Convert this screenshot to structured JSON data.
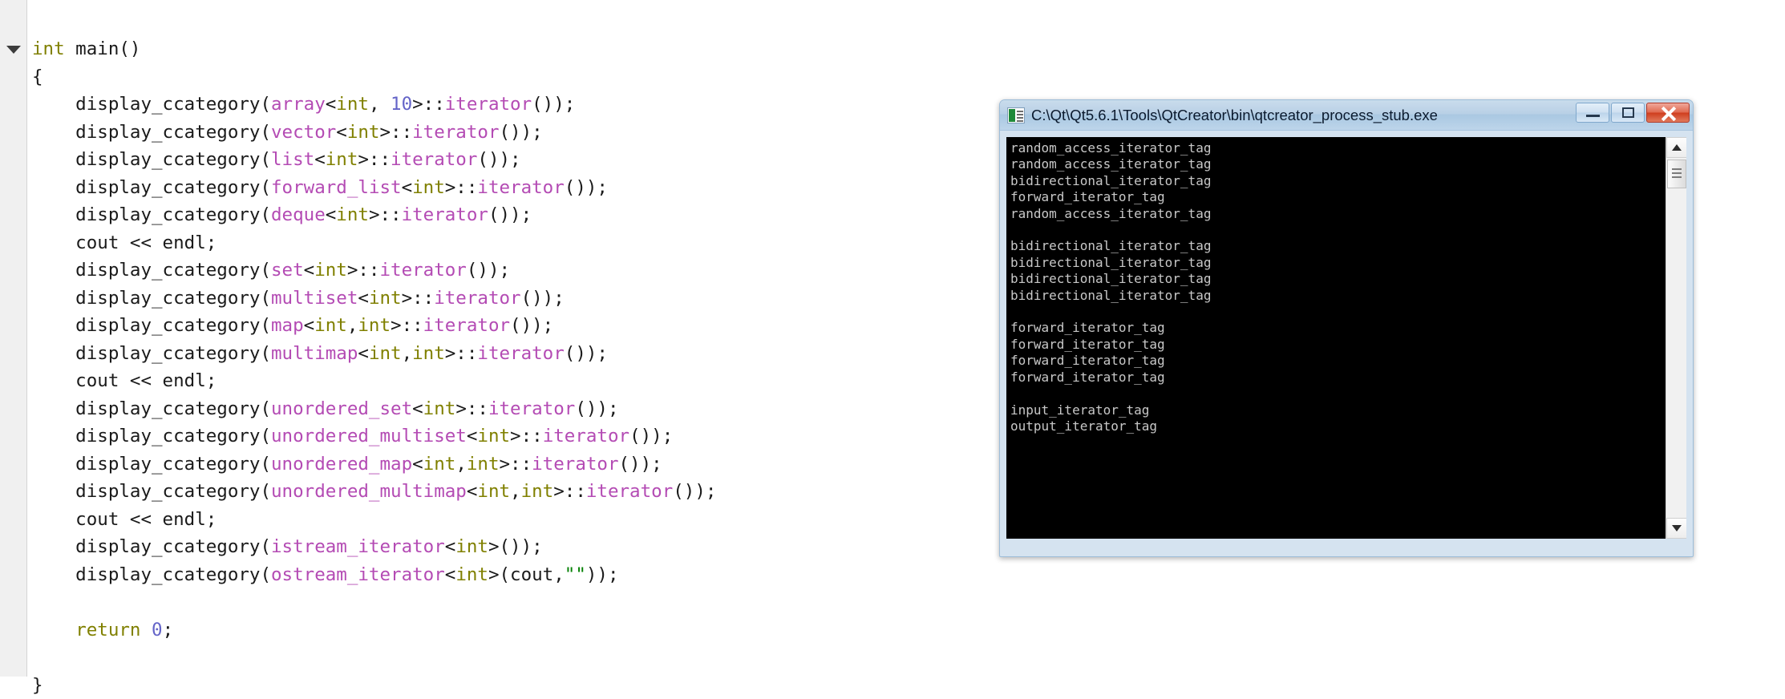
{
  "editor": {
    "fold_marker": "▼",
    "code_lines": [
      [
        {
          "t": "int",
          "c": "kw"
        },
        {
          "t": " main()",
          "c": "pln"
        }
      ],
      [
        {
          "t": "{",
          "c": "pln"
        }
      ],
      [
        {
          "t": "    display_ccategory(",
          "c": "pln"
        },
        {
          "t": "array",
          "c": "typ"
        },
        {
          "t": "<",
          "c": "pln"
        },
        {
          "t": "int",
          "c": "kw"
        },
        {
          "t": ", ",
          "c": "pln"
        },
        {
          "t": "10",
          "c": "num"
        },
        {
          "t": ">::",
          "c": "pln"
        },
        {
          "t": "iterator",
          "c": "typ"
        },
        {
          "t": "());",
          "c": "pln"
        }
      ],
      [
        {
          "t": "    display_ccategory(",
          "c": "pln"
        },
        {
          "t": "vector",
          "c": "typ"
        },
        {
          "t": "<",
          "c": "pln"
        },
        {
          "t": "int",
          "c": "kw"
        },
        {
          "t": ">::",
          "c": "pln"
        },
        {
          "t": "iterator",
          "c": "typ"
        },
        {
          "t": "());",
          "c": "pln"
        }
      ],
      [
        {
          "t": "    display_ccategory(",
          "c": "pln"
        },
        {
          "t": "list",
          "c": "typ"
        },
        {
          "t": "<",
          "c": "pln"
        },
        {
          "t": "int",
          "c": "kw"
        },
        {
          "t": ">::",
          "c": "pln"
        },
        {
          "t": "iterator",
          "c": "typ"
        },
        {
          "t": "());",
          "c": "pln"
        }
      ],
      [
        {
          "t": "    display_ccategory(",
          "c": "pln"
        },
        {
          "t": "forward_list",
          "c": "typ"
        },
        {
          "t": "<",
          "c": "pln"
        },
        {
          "t": "int",
          "c": "kw"
        },
        {
          "t": ">::",
          "c": "pln"
        },
        {
          "t": "iterator",
          "c": "typ"
        },
        {
          "t": "());",
          "c": "pln"
        }
      ],
      [
        {
          "t": "    display_ccategory(",
          "c": "pln"
        },
        {
          "t": "deque",
          "c": "typ"
        },
        {
          "t": "<",
          "c": "pln"
        },
        {
          "t": "int",
          "c": "kw"
        },
        {
          "t": ">::",
          "c": "pln"
        },
        {
          "t": "iterator",
          "c": "typ"
        },
        {
          "t": "());",
          "c": "pln"
        }
      ],
      [
        {
          "t": "    cout << endl;",
          "c": "pln"
        }
      ],
      [
        {
          "t": "    display_ccategory(",
          "c": "pln"
        },
        {
          "t": "set",
          "c": "typ"
        },
        {
          "t": "<",
          "c": "pln"
        },
        {
          "t": "int",
          "c": "kw"
        },
        {
          "t": ">::",
          "c": "pln"
        },
        {
          "t": "iterator",
          "c": "typ"
        },
        {
          "t": "());",
          "c": "pln"
        }
      ],
      [
        {
          "t": "    display_ccategory(",
          "c": "pln"
        },
        {
          "t": "multiset",
          "c": "typ"
        },
        {
          "t": "<",
          "c": "pln"
        },
        {
          "t": "int",
          "c": "kw"
        },
        {
          "t": ">::",
          "c": "pln"
        },
        {
          "t": "iterator",
          "c": "typ"
        },
        {
          "t": "());",
          "c": "pln"
        }
      ],
      [
        {
          "t": "    display_ccategory(",
          "c": "pln"
        },
        {
          "t": "map",
          "c": "typ"
        },
        {
          "t": "<",
          "c": "pln"
        },
        {
          "t": "int",
          "c": "kw"
        },
        {
          "t": ",",
          "c": "pln"
        },
        {
          "t": "int",
          "c": "kw"
        },
        {
          "t": ">::",
          "c": "pln"
        },
        {
          "t": "iterator",
          "c": "typ"
        },
        {
          "t": "());",
          "c": "pln"
        }
      ],
      [
        {
          "t": "    display_ccategory(",
          "c": "pln"
        },
        {
          "t": "multimap",
          "c": "typ"
        },
        {
          "t": "<",
          "c": "pln"
        },
        {
          "t": "int",
          "c": "kw"
        },
        {
          "t": ",",
          "c": "pln"
        },
        {
          "t": "int",
          "c": "kw"
        },
        {
          "t": ">::",
          "c": "pln"
        },
        {
          "t": "iterator",
          "c": "typ"
        },
        {
          "t": "());",
          "c": "pln"
        }
      ],
      [
        {
          "t": "    cout << endl;",
          "c": "pln"
        }
      ],
      [
        {
          "t": "    display_ccategory(",
          "c": "pln"
        },
        {
          "t": "unordered_set",
          "c": "typ"
        },
        {
          "t": "<",
          "c": "pln"
        },
        {
          "t": "int",
          "c": "kw"
        },
        {
          "t": ">::",
          "c": "pln"
        },
        {
          "t": "iterator",
          "c": "typ"
        },
        {
          "t": "());",
          "c": "pln"
        }
      ],
      [
        {
          "t": "    display_ccategory(",
          "c": "pln"
        },
        {
          "t": "unordered_multiset",
          "c": "typ"
        },
        {
          "t": "<",
          "c": "pln"
        },
        {
          "t": "int",
          "c": "kw"
        },
        {
          "t": ">::",
          "c": "pln"
        },
        {
          "t": "iterator",
          "c": "typ"
        },
        {
          "t": "());",
          "c": "pln"
        }
      ],
      [
        {
          "t": "    display_ccategory(",
          "c": "pln"
        },
        {
          "t": "unordered_map",
          "c": "typ"
        },
        {
          "t": "<",
          "c": "pln"
        },
        {
          "t": "int",
          "c": "kw"
        },
        {
          "t": ",",
          "c": "pln"
        },
        {
          "t": "int",
          "c": "kw"
        },
        {
          "t": ">::",
          "c": "pln"
        },
        {
          "t": "iterator",
          "c": "typ"
        },
        {
          "t": "());",
          "c": "pln"
        }
      ],
      [
        {
          "t": "    display_ccategory(",
          "c": "pln"
        },
        {
          "t": "unordered_multimap",
          "c": "typ"
        },
        {
          "t": "<",
          "c": "pln"
        },
        {
          "t": "int",
          "c": "kw"
        },
        {
          "t": ",",
          "c": "pln"
        },
        {
          "t": "int",
          "c": "kw"
        },
        {
          "t": ">::",
          "c": "pln"
        },
        {
          "t": "iterator",
          "c": "typ"
        },
        {
          "t": "());",
          "c": "pln"
        }
      ],
      [
        {
          "t": "    cout << endl;",
          "c": "pln"
        }
      ],
      [
        {
          "t": "    display_ccategory(",
          "c": "pln"
        },
        {
          "t": "istream_iterator",
          "c": "typ"
        },
        {
          "t": "<",
          "c": "pln"
        },
        {
          "t": "int",
          "c": "kw"
        },
        {
          "t": ">());",
          "c": "pln"
        }
      ],
      [
        {
          "t": "    display_ccategory(",
          "c": "pln"
        },
        {
          "t": "ostream_iterator",
          "c": "typ"
        },
        {
          "t": "<",
          "c": "pln"
        },
        {
          "t": "int",
          "c": "kw"
        },
        {
          "t": ">(cout,",
          "c": "pln"
        },
        {
          "t": "\"\"",
          "c": "str"
        },
        {
          "t": "));",
          "c": "pln"
        }
      ],
      [
        {
          "t": "",
          "c": "pln"
        }
      ],
      [
        {
          "t": "    ",
          "c": "pln"
        },
        {
          "t": "return",
          "c": "kw"
        },
        {
          "t": " ",
          "c": "pln"
        },
        {
          "t": "0",
          "c": "num"
        },
        {
          "t": ";",
          "c": "pln"
        }
      ],
      [
        {
          "t": "",
          "c": "pln"
        }
      ],
      [
        {
          "t": "}",
          "c": "pln"
        }
      ]
    ],
    "colors": {
      "background": "#ffffff",
      "gutter": "#f0f0f0",
      "text": "#1a1a1a",
      "keyword": "#808000",
      "type": "#b44bb4",
      "number": "#6464c8",
      "string": "#008000"
    }
  },
  "console_window": {
    "title": "C:\\Qt\\Qt5.6.1\\Tools\\QtCreator\\bin\\qtcreator_process_stub.exe",
    "icon": "console-app-icon",
    "buttons": {
      "minimize": "minimize-icon",
      "maximize": "maximize-icon",
      "close": "close-icon"
    },
    "output": "random_access_iterator_tag\nrandom_access_iterator_tag\nbidirectional_iterator_tag\nforward_iterator_tag\nrandom_access_iterator_tag\n\nbidirectional_iterator_tag\nbidirectional_iterator_tag\nbidirectional_iterator_tag\nbidirectional_iterator_tag\n\nforward_iterator_tag\nforward_iterator_tag\nforward_iterator_tag\nforward_iterator_tag\n\ninput_iterator_tag\noutput_iterator_tag",
    "scrollbar": {
      "up_arrow": "▲",
      "down_arrow": "▼"
    },
    "colors": {
      "titlebar": "#b9d0e6",
      "frame": "#d5e3f0",
      "console_bg": "#000000",
      "console_fg": "#c8c8c8",
      "close_button": "#cf3d1e"
    }
  }
}
